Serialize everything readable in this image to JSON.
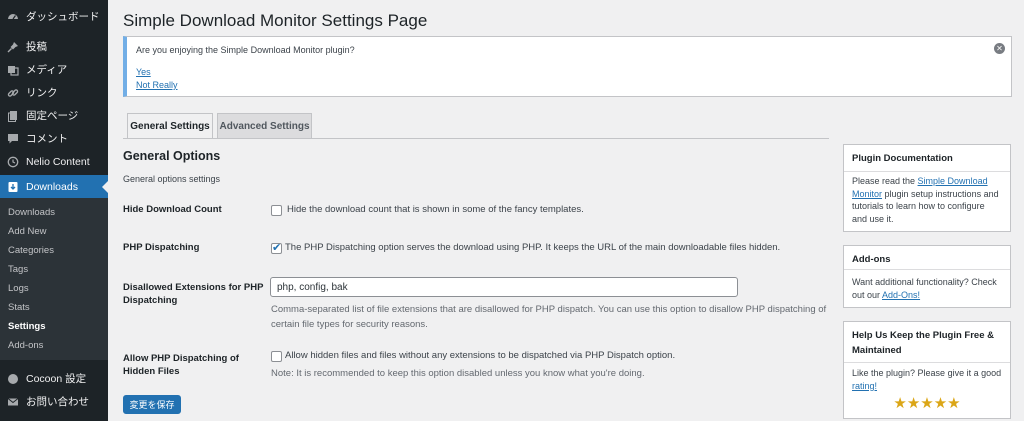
{
  "sidebar": {
    "items": [
      {
        "label": "ダッシュボード",
        "icon": "dashboard-icon"
      },
      {
        "label": "投稿",
        "icon": "pin-icon"
      },
      {
        "label": "メディア",
        "icon": "media-icon"
      },
      {
        "label": "リンク",
        "icon": "link-icon"
      },
      {
        "label": "固定ページ",
        "icon": "page-icon"
      },
      {
        "label": "コメント",
        "icon": "comment-icon"
      },
      {
        "label": "Nelio Content",
        "icon": "nelio-icon"
      },
      {
        "label": "Downloads",
        "icon": "download-icon"
      },
      {
        "label": "Cocoon 設定",
        "icon": "cocoon-icon"
      },
      {
        "label": "お問い合わせ",
        "icon": "mail-icon"
      }
    ],
    "submenu": [
      "Downloads",
      "Add New",
      "Categories",
      "Tags",
      "Logs",
      "Stats",
      "Settings",
      "Add-ons"
    ]
  },
  "page": {
    "title": "Simple Download Monitor Settings Page"
  },
  "notice": {
    "message": "Are you enjoying the Simple Download Monitor plugin?",
    "yes": "Yes",
    "no": "Not Really",
    "close": "✕"
  },
  "tabs": {
    "general": "General Settings",
    "advanced": "Advanced Settings"
  },
  "section": {
    "title": "General Options",
    "description": "General options settings"
  },
  "settings": {
    "hide_count": {
      "label": "Hide Download Count",
      "text": "Hide the download count that is shown in some of the fancy templates.",
      "checked": false
    },
    "php_dispatch": {
      "label": "PHP Dispatching",
      "text": "The PHP Dispatching option serves the download using PHP. It keeps the URL of the main downloadable files hidden.",
      "checked": true
    },
    "disallowed_ext": {
      "label_line1": "Disallowed Extensions for PHP",
      "label_line2": "Dispatching",
      "value": "php, config, bak",
      "desc_line1": "Comma-separated list of file extensions that are disallowed for PHP dispatch. You can use this option to disallow PHP dispatching of",
      "desc_line2": "certain file types for security reasons."
    },
    "allow_hidden": {
      "label_line1": "Allow PHP Dispatching of",
      "label_line2": "Hidden Files",
      "text": "Allow hidden files and files without any extensions to be dispatched via PHP Dispatch option.",
      "note": "Note: It is recommended to keep this option disabled unless you know what you're doing.",
      "checked": false
    }
  },
  "save_button": "変更を保存",
  "boxes": {
    "docs": {
      "title": "Plugin Documentation",
      "pre": "Please read the ",
      "link": "Simple Download Monitor",
      "post": " plugin setup instructions and tutorials to learn how to configure and use it."
    },
    "addons": {
      "title": "Add-ons",
      "pre": "Want additional functionality? Check out our ",
      "link": "Add-Ons!"
    },
    "help": {
      "title_line1": "Help Us Keep the Plugin Free &",
      "title_line2": "Maintained",
      "pre": "Like the plugin? Please give it a good ",
      "link": "rating!",
      "stars": "★★★★★",
      "rating": 5
    }
  },
  "colors": {
    "sidebar_bg": "#1d2327",
    "accent": "#2271b1",
    "notice_border": "#72aee6",
    "star": "#dba617"
  }
}
